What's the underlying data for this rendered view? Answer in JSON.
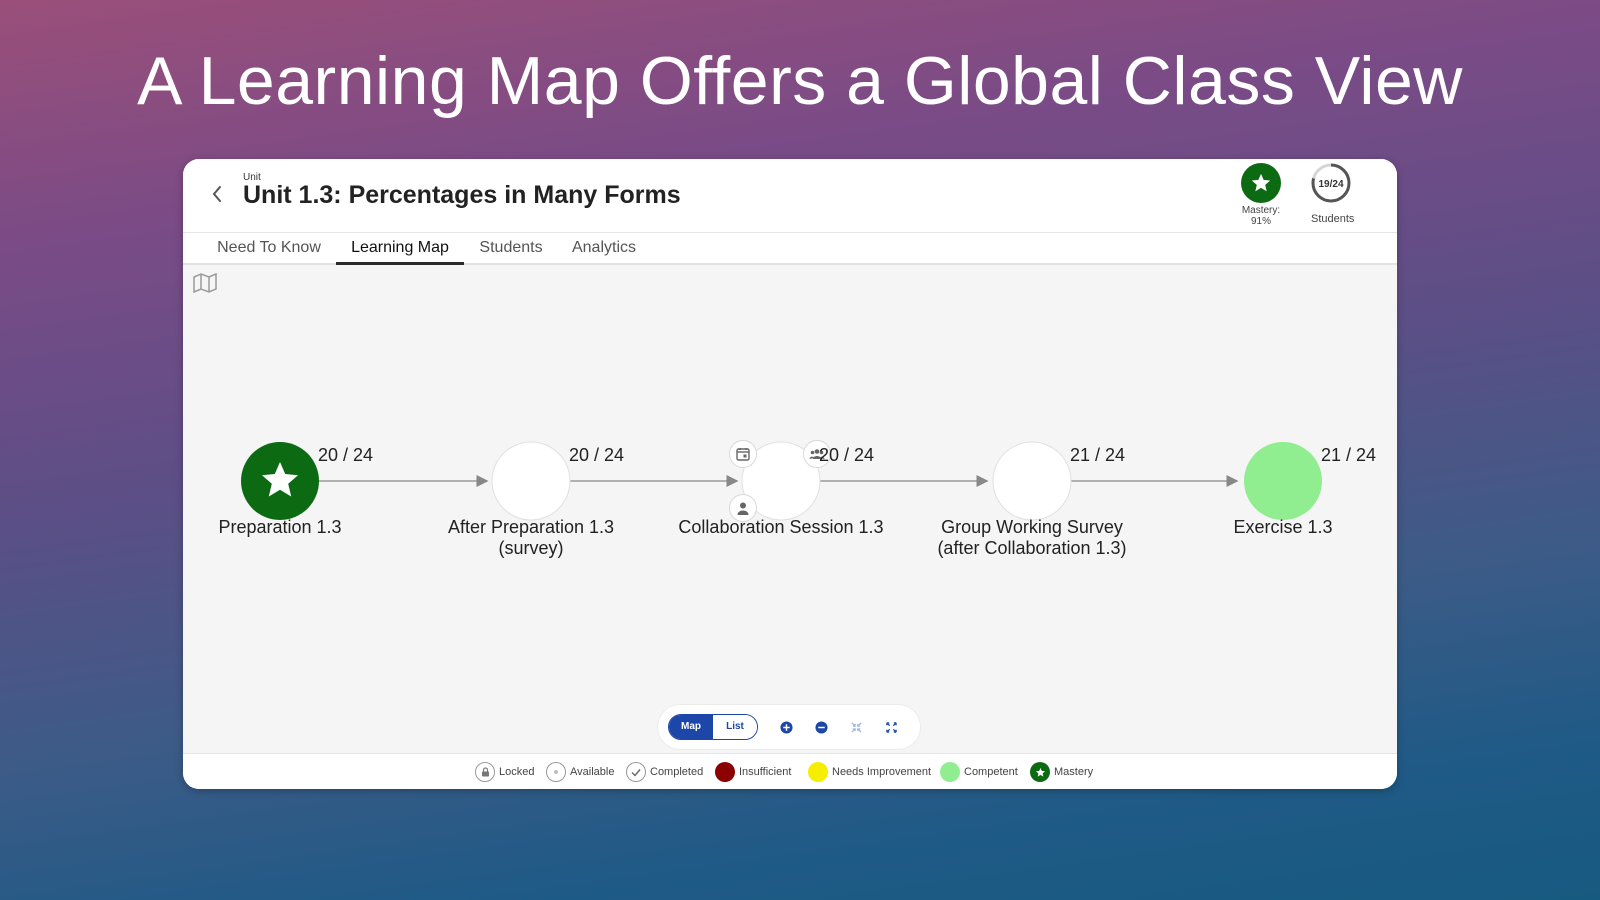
{
  "slide": {
    "title": "A Learning Map Offers a Global Class View"
  },
  "header": {
    "eyebrow": "Unit",
    "title": "Unit 1.3: Percentages in Many Forms",
    "mastery_label_line1": "Mastery:",
    "mastery_label_line2": "91%",
    "students_count": "19/24",
    "students_progress": 0.79,
    "students_label": "Students"
  },
  "tabs": [
    {
      "label": "Need To Know",
      "active": false
    },
    {
      "label": "Learning Map",
      "active": true
    },
    {
      "label": "Students",
      "active": false
    },
    {
      "label": "Analytics",
      "active": false
    }
  ],
  "nodes": [
    {
      "label_line1": "Preparation 1.3",
      "label_line2": "",
      "count": "20 / 24",
      "status": "mastery"
    },
    {
      "label_line1": "After Preparation 1.3",
      "label_line2": "(survey)",
      "count": "20 / 24",
      "status": "available"
    },
    {
      "label_line1": "Collaboration Session 1.3",
      "label_line2": "",
      "count": "20 / 24",
      "status": "available"
    },
    {
      "label_line1": "Group Working Survey",
      "label_line2": "(after Collaboration 1.3)",
      "count": "21 / 24",
      "status": "available"
    },
    {
      "label_line1": "Exercise 1.3",
      "label_line2": "",
      "count": "21 / 24",
      "status": "competent"
    }
  ],
  "toolbar": {
    "map_label": "Map",
    "list_label": "List"
  },
  "legend": [
    {
      "label": "Locked",
      "icon": "lock-icon"
    },
    {
      "label": "Available",
      "icon": "dot-icon"
    },
    {
      "label": "Completed",
      "icon": "check-icon"
    },
    {
      "label": "Insufficient",
      "icon": "",
      "color": "#8b0000"
    },
    {
      "label": "Needs Improvement",
      "icon": "",
      "color": "#f5ee00"
    },
    {
      "label": "Competent",
      "icon": "",
      "color": "#90ee90"
    },
    {
      "label": "Mastery",
      "icon": "star-icon",
      "color": "#0c6a12"
    }
  ],
  "colors": {
    "mastery": "#0c6a12",
    "competent": "#90ee90",
    "available": "#ffffff",
    "accent": "#1c46a8"
  }
}
